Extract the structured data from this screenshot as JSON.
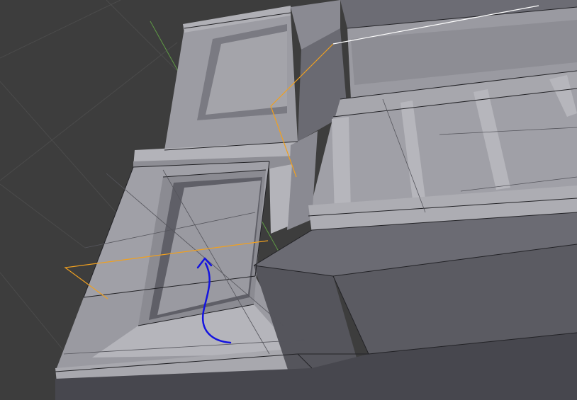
{
  "viewport": {
    "background_color": "#3d3d3d",
    "grid_color": "#4b4b4b",
    "y_axis_color": "#5f9a45",
    "mesh_face_light": "#9c9ca3",
    "mesh_face_mid": "#84848c",
    "mesh_face_dark": "#5b5b62",
    "mesh_face_darkest": "#47474e",
    "wire_color": "#222226",
    "selection_color": "#f0a020",
    "active_edge_color": "#ffffff",
    "annotation_color": "#1414e0"
  }
}
